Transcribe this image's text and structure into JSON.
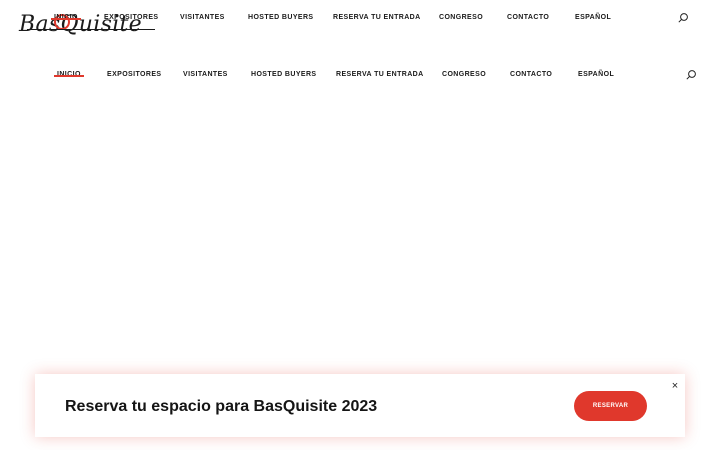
{
  "logo": {
    "text": "BasQuisite"
  },
  "nav": {
    "items": [
      "INICIO",
      "EXPOSITORES",
      "VISITANTES",
      "HOSTED BUYERS",
      "RESERVA TU ENTRADA",
      "CONGRESO",
      "CONTACTO",
      "ESPAÑOL"
    ],
    "active_index": 0,
    "search_icon": "search-icon"
  },
  "promo": {
    "title": "Reserva tu espacio para BasQuisite 2023",
    "button_label": "RESERVAR",
    "close_glyph": "×"
  },
  "colors": {
    "accent": "#e0382c",
    "text": "#1a1a1a",
    "background": "#ffffff"
  }
}
